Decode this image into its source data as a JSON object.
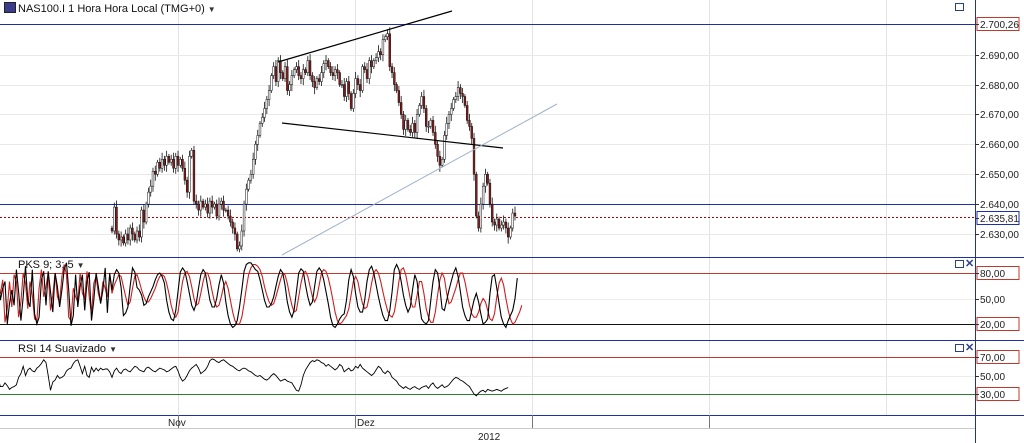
{
  "main": {
    "symbol_label": "NAS100.I 1 Hora Hora Local (TMG+0)",
    "price_ticks": [
      {
        "v": 2690,
        "label": "2.690,00"
      },
      {
        "v": 2680,
        "label": "2.680,00"
      },
      {
        "v": 2670,
        "label": "2.670,00"
      },
      {
        "v": 2660,
        "label": "2.660,00"
      },
      {
        "v": 2650,
        "label": "2.650,00"
      },
      {
        "v": 2640,
        "label": "2.640,00"
      },
      {
        "v": 2630,
        "label": "2.630,00"
      }
    ],
    "level_high": {
      "v": 2700.26,
      "label": "2.700,26",
      "color": "#1f2fa8"
    },
    "level_support": {
      "v": 2640,
      "color": "#1f2fa8"
    },
    "current_price": {
      "v": 2635.81,
      "label": "2.635,81",
      "color": "#b00000"
    }
  },
  "stochastic": {
    "label": "PKS 9; 3; 5",
    "ticks": [
      {
        "v": 80,
        "label": "80,00",
        "boxed": true,
        "color": "#c0392b"
      },
      {
        "v": 50,
        "label": "50,00",
        "boxed": false
      },
      {
        "v": 20,
        "label": "20,00",
        "boxed": true,
        "color": "#c0392b"
      }
    ]
  },
  "rsi": {
    "label": "RSI 14 Suavizado",
    "ticks": [
      {
        "v": 70,
        "label": "70,00",
        "boxed": true,
        "color": "#c0392b"
      },
      {
        "v": 50,
        "label": "50,00",
        "boxed": false
      },
      {
        "v": 30,
        "label": "30,00",
        "boxed": true,
        "color": "#c0392b"
      }
    ]
  },
  "time_axis": {
    "months": [
      {
        "label": "Nov",
        "bar": 20
      },
      {
        "label": "Dez",
        "bar": 178
      }
    ],
    "year": "2012"
  },
  "chart_data": {
    "type": "line",
    "title": "NAS100.I 1 Hora Hora Local (TMG+0)",
    "xlabel": "",
    "ylabel": "",
    "ylim": [
      2624,
      2708
    ],
    "x_categories": [
      "Nov",
      "Dez",
      "2012"
    ],
    "series": [
      {
        "name": "NAS100.I",
        "style": "candlestick close path",
        "values": [
          2631,
          2639,
          2630,
          2628,
          2629,
          2627,
          2630,
          2628,
          2632,
          2630,
          2628,
          2631,
          2629,
          2638,
          2634,
          2640,
          2644,
          2646,
          2651,
          2650,
          2654,
          2652,
          2655,
          2653,
          2656,
          2654,
          2655,
          2652,
          2656,
          2653,
          2655,
          2652,
          2648,
          2644,
          2656,
          2658,
          2641,
          2640,
          2638,
          2641,
          2639,
          2640,
          2637,
          2641,
          2639,
          2640,
          2636,
          2640,
          2641,
          2638,
          2638,
          2636,
          2634,
          2632,
          2630,
          2625,
          2626,
          2631,
          2640,
          2645,
          2648,
          2650,
          2655,
          2660,
          2663,
          2667,
          2669,
          2672,
          2675,
          2678,
          2683,
          2686,
          2681,
          2688,
          2684,
          2682,
          2686,
          2678,
          2680,
          2683,
          2685,
          2686,
          2683,
          2682,
          2685,
          2684,
          2688,
          2683,
          2681,
          2679,
          2682,
          2681,
          2684,
          2687,
          2688,
          2686,
          2684,
          2683,
          2685,
          2684,
          2680,
          2680,
          2676,
          2681,
          2677,
          2672,
          2677,
          2682,
          2680,
          2678,
          2686,
          2685,
          2682,
          2688,
          2686,
          2688,
          2689,
          2691,
          2690,
          2695,
          2696,
          2697,
          2686,
          2684,
          2680,
          2678,
          2674,
          2670,
          2665,
          2668,
          2665,
          2664,
          2667,
          2664,
          2670,
          2673,
          2676,
          2672,
          2666,
          2666,
          2668,
          2664,
          2660,
          2656,
          2653,
          2655,
          2663,
          2667,
          2670,
          2672,
          2675,
          2676,
          2679,
          2677,
          2676,
          2673,
          2668,
          2666,
          2662,
          2650,
          2636,
          2632,
          2640,
          2646,
          2650,
          2647,
          2640,
          2634,
          2633,
          2635,
          2632,
          2633,
          2634,
          2632,
          2629,
          2632,
          2637,
          2636
        ]
      },
      {
        "name": "PKS %K",
        "values": [
          60,
          78,
          84,
          80,
          63,
          30,
          33,
          40,
          65,
          86,
          81,
          63,
          60,
          54,
          42,
          44,
          52,
          58,
          64,
          72,
          78,
          80,
          76,
          68,
          48,
          34,
          26,
          24,
          36,
          58,
          81,
          86,
          82,
          70,
          56,
          42,
          36,
          44,
          62,
          78,
          84,
          80,
          64,
          48,
          40,
          40,
          50,
          66,
          78,
          68,
          46,
          30,
          20,
          16,
          18,
          24,
          40,
          60,
          82,
          90,
          92,
          92,
          88,
          84,
          82,
          72,
          60,
          48,
          40,
          40,
          44,
          52,
          64,
          76,
          84,
          80,
          66,
          46,
          34,
          28,
          36,
          58,
          80,
          85,
          82,
          66,
          52,
          42,
          46,
          64,
          82,
          86,
          82,
          72,
          58,
          44,
          28,
          18,
          16,
          20,
          26,
          30,
          32,
          48,
          72,
          84,
          76,
          56,
          40,
          34,
          34,
          48,
          70,
          84,
          88,
          80,
          66,
          52,
          40,
          30,
          24,
          24,
          36,
          58,
          84,
          90,
          84,
          70,
          54,
          42,
          34,
          40,
          60,
          78,
          70,
          44,
          26,
          22,
          20,
          24,
          48,
          70,
          84,
          80,
          62,
          38,
          36,
          48,
          60,
          70,
          80,
          86,
          76,
          58,
          40,
          30,
          24,
          24,
          36,
          48,
          56,
          46,
          32,
          20,
          22,
          26,
          56,
          76,
          78,
          62,
          44,
          28,
          20,
          16,
          24,
          30,
          36,
          50,
          74
        ]
      },
      {
        "name": "PKS %D",
        "values": [
          56,
          66,
          72,
          78,
          76,
          64,
          52,
          42,
          46,
          62,
          76,
          78,
          70,
          60,
          52,
          46,
          46,
          50,
          56,
          62,
          70,
          76,
          78,
          76,
          68,
          56,
          42,
          32,
          28,
          34,
          52,
          70,
          80,
          82,
          76,
          64,
          50,
          42,
          44,
          56,
          70,
          80,
          80,
          72,
          58,
          46,
          40,
          42,
          52,
          64,
          70,
          62,
          48,
          34,
          24,
          20,
          20,
          28,
          44,
          62,
          78,
          86,
          90,
          90,
          88,
          84,
          76,
          64,
          54,
          46,
          42,
          44,
          52,
          62,
          72,
          80,
          78,
          68,
          54,
          42,
          34,
          36,
          52,
          68,
          80,
          82,
          76,
          64,
          52,
          46,
          52,
          66,
          80,
          84,
          82,
          74,
          62,
          48,
          34,
          24,
          20,
          22,
          26,
          30,
          38,
          54,
          70,
          76,
          70,
          56,
          44,
          38,
          40,
          52,
          68,
          80,
          84,
          80,
          70,
          58,
          46,
          36,
          30,
          28,
          34,
          50,
          70,
          84,
          86,
          78,
          64,
          50,
          40,
          40,
          54,
          70,
          70,
          56,
          38,
          28,
          22,
          22,
          34,
          54,
          72,
          80,
          74,
          56,
          44,
          46,
          54,
          62,
          72,
          80,
          80,
          70,
          56,
          42,
          32,
          28,
          28,
          34,
          44,
          50,
          46,
          36,
          26,
          24,
          32,
          52,
          68,
          74,
          66,
          50,
          36,
          26,
          20,
          22,
          28,
          34,
          42
        ]
      },
      {
        "name": "RSI 14 Suavizado",
        "values": [
          48,
          55,
          58,
          54,
          52,
          56,
          57,
          55,
          54,
          57,
          60,
          59,
          56,
          55,
          54,
          58,
          59,
          57,
          55,
          54,
          56,
          58,
          57,
          56,
          54,
          55,
          57,
          59,
          60,
          55,
          48,
          44,
          46,
          50,
          55,
          58,
          60,
          62,
          58,
          52,
          54,
          56,
          60,
          66,
          68,
          67,
          65,
          64,
          66,
          67,
          65,
          63,
          61,
          60,
          58,
          56,
          55,
          57,
          58,
          57,
          55,
          54,
          52,
          50,
          49,
          50,
          48,
          46,
          45,
          47,
          50,
          52,
          50,
          47,
          44,
          45,
          46,
          44,
          43,
          42,
          38,
          34,
          33,
          40,
          50,
          56,
          60,
          64,
          66,
          65,
          67,
          66,
          64,
          63,
          60,
          62,
          60,
          58,
          56,
          58,
          62,
          60,
          54,
          56,
          58,
          55,
          56,
          60,
          58,
          62,
          58,
          56,
          54,
          52,
          50,
          52,
          56,
          60,
          58,
          54,
          52,
          55,
          53,
          48,
          46,
          44,
          40,
          38,
          36,
          38,
          36,
          35,
          37,
          38,
          36,
          35,
          37,
          38,
          39,
          36,
          40,
          42,
          38,
          36,
          38,
          40,
          37,
          38,
          40,
          43,
          46,
          48,
          47,
          45,
          44,
          42,
          40,
          38,
          34,
          30,
          28,
          31,
          33,
          34,
          32,
          35,
          34,
          33,
          34,
          35,
          34,
          33,
          35,
          36,
          37
        ]
      }
    ],
    "price_panel_ylim": [
      2624,
      2708
    ],
    "stochastic_ylim": [
      0,
      100
    ],
    "rsi_ylim": [
      0,
      100
    ],
    "grid": true,
    "legend": "none"
  }
}
